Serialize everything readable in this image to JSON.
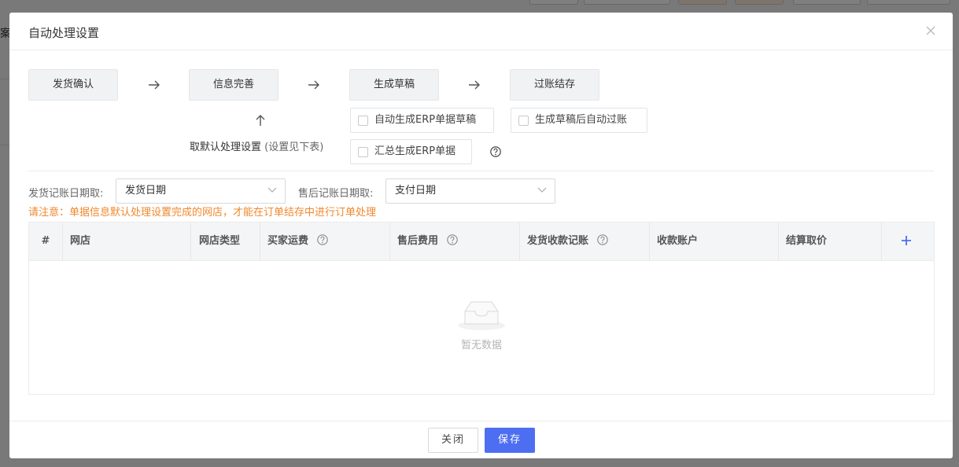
{
  "background": {
    "fragment_text": "案"
  },
  "dialog": {
    "title": "自动处理设置"
  },
  "flow": {
    "steps": [
      "发货确认",
      "信息完善",
      "生成草稿",
      "过账结存"
    ],
    "default_label": "取默认处理设置",
    "default_sub": "(设置见下表)",
    "options": {
      "auto_draft": "自动生成ERP单据草稿",
      "auto_post": "生成草稿后自动过账",
      "merge": "汇总生成ERP单据"
    }
  },
  "filters": {
    "ship_label": "发货记账日期取:",
    "ship_value": "发货日期",
    "after_label": "售后记账日期取:",
    "after_value": "支付日期"
  },
  "notice": "请注意：单据信息默认处理设置完成的网店，才能在订单结存中进行订单处理",
  "table": {
    "columns": [
      "#",
      "网店",
      "网店类型",
      "买家运费",
      "售后费用",
      "发货收款记账",
      "收款账户",
      "结算取价"
    ],
    "empty_text": "暂无数据"
  },
  "footer": {
    "close_label": "关闭",
    "save_label": "保存"
  },
  "colors": {
    "primary": "#4e6ef2",
    "warning": "#f0882d"
  }
}
